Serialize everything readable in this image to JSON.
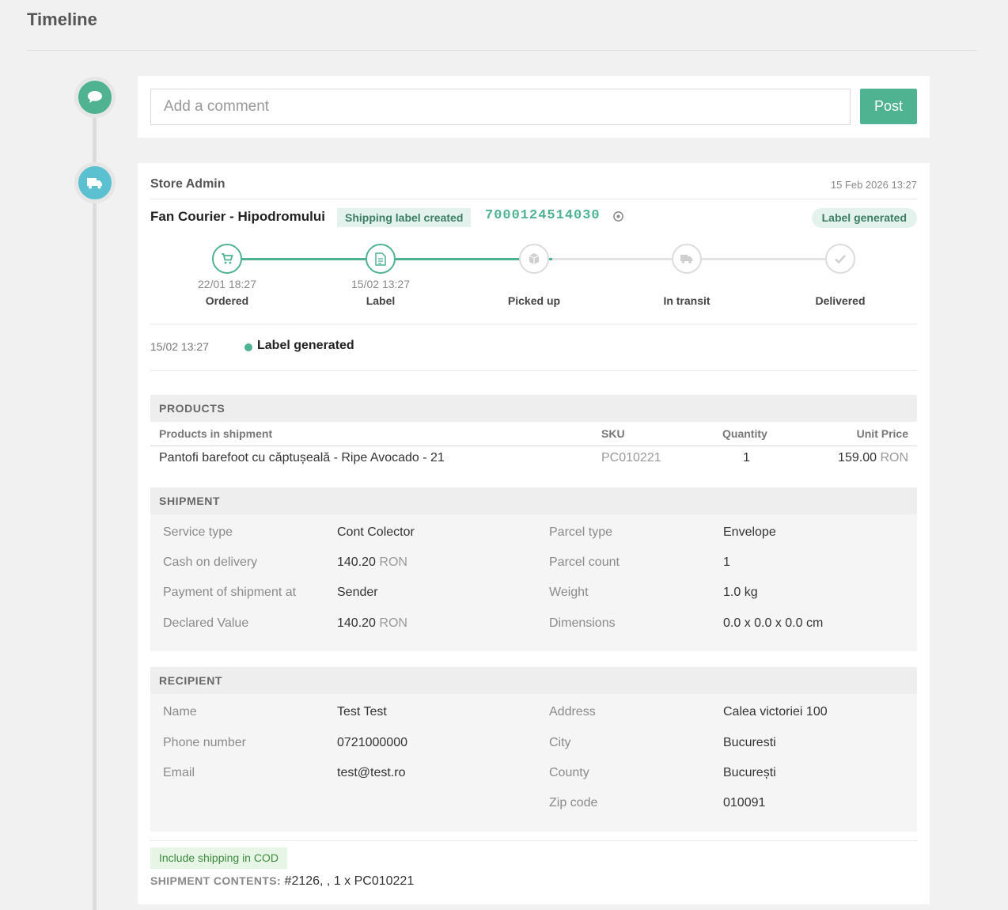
{
  "page": {
    "title": "Timeline"
  },
  "comment": {
    "placeholder": "Add a comment",
    "post_label": "Post"
  },
  "shipment_entry": {
    "author": "Store Admin",
    "datetime": "15 Feb 2026 13:27",
    "courier": "Fan Courier - Hipodromului",
    "status_tag": "Shipping label created",
    "tracking_number": "7000124514030",
    "state_pill": "Label generated",
    "progress_fraction": 0.53,
    "steps": [
      {
        "label": "Ordered",
        "date": "22/01 18:27",
        "icon": "cart-icon",
        "done": true
      },
      {
        "label": "Label",
        "date": "15/02 13:27",
        "icon": "document-icon",
        "done": true
      },
      {
        "label": "Picked up",
        "date": "",
        "icon": "box-icon",
        "done": false
      },
      {
        "label": "In transit",
        "date": "",
        "icon": "truck-icon",
        "done": false
      },
      {
        "label": "Delivered",
        "date": "",
        "icon": "check-icon",
        "done": false
      }
    ],
    "event": {
      "time": "15/02 13:27",
      "text": "Label generated"
    }
  },
  "products": {
    "title": "PRODUCTS",
    "headers": {
      "name": "Products in shipment",
      "sku": "SKU",
      "quantity": "Quantity",
      "unit_price": "Unit Price"
    },
    "rows": [
      {
        "name": "Pantofi barefoot cu căptușeală - Ripe Avocado - 21",
        "sku": "PC010221",
        "quantity": "1",
        "price": "159.00",
        "currency": "RON"
      }
    ]
  },
  "shipment": {
    "title": "SHIPMENT",
    "left": [
      {
        "label": "Service type",
        "value": "Cont Colector",
        "unit": ""
      },
      {
        "label": "Cash on delivery",
        "value": "140.20",
        "unit": "RON"
      },
      {
        "label": "Payment of shipment at",
        "value": "Sender",
        "unit": ""
      },
      {
        "label": "Declared Value",
        "value": "140.20",
        "unit": "RON"
      }
    ],
    "right": [
      {
        "label": "Parcel type",
        "value": "Envelope",
        "unit": ""
      },
      {
        "label": "Parcel count",
        "value": "1",
        "unit": ""
      },
      {
        "label": "Weight",
        "value": "1.0 kg",
        "unit": ""
      },
      {
        "label": "Dimensions",
        "value": "0.0 x 0.0 x 0.0 cm",
        "unit": ""
      }
    ]
  },
  "recipient": {
    "title": "RECIPIENT",
    "left": [
      {
        "label": "Name",
        "value": "Test Test"
      },
      {
        "label": "Phone number",
        "value": "0721000000"
      },
      {
        "label": "Email",
        "value": "test@test.ro"
      }
    ],
    "right": [
      {
        "label": "Address",
        "value": "Calea victoriei 100"
      },
      {
        "label": "City",
        "value": "Bucuresti"
      },
      {
        "label": "County",
        "value": "București"
      },
      {
        "label": "Zip code",
        "value": "010091"
      }
    ]
  },
  "footer": {
    "cod_badge": "Include shipping in COD",
    "contents_label": "SHIPMENT CONTENTS:",
    "contents_value": "#2126, , 1 x PC010221"
  },
  "colors": {
    "accent": "#4fb392",
    "truck_icon_bg": "#5bc0cf",
    "tag_bg": "#e3f2ec",
    "cod_bg": "#e6f5e6"
  }
}
